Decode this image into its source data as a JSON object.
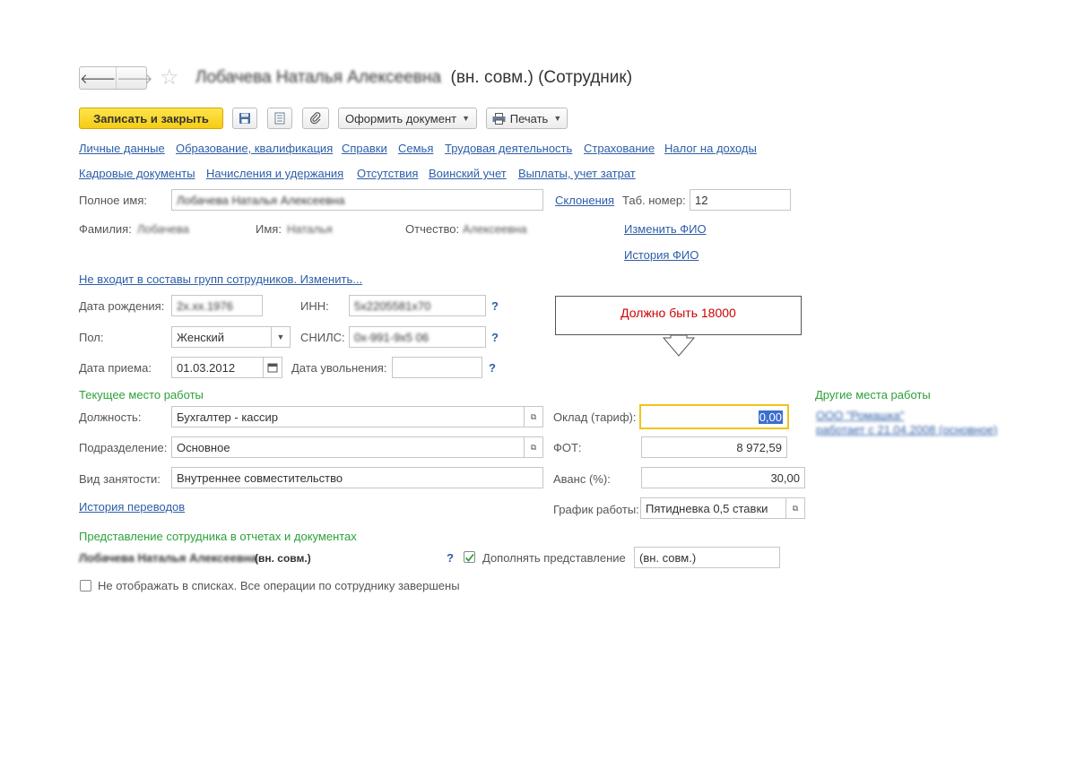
{
  "window": {
    "title_name": "Лобачева Наталья Алексеевна",
    "title_suffix": "(вн. совм.) (Сотрудник)",
    "back_glyph": "🡐",
    "forward_glyph": "🡒",
    "star_glyph": "☆"
  },
  "toolbar": {
    "save_close": "Записать и закрыть",
    "create_document": "Оформить документ",
    "print": "Печать"
  },
  "links_row1": [
    "Личные данные",
    "Образование, квалификация",
    "Справки",
    "Семья",
    "Трудовая деятельность",
    "Страхование",
    "Налог на доходы"
  ],
  "links_row2": [
    "Кадровые документы",
    "Начисления и удержания",
    "Отсутствия",
    "Воинский учет",
    "Выплаты, учет затрат"
  ],
  "name": {
    "full_name_label": "Полное имя:",
    "full_name_value": "Лобачева Наталья Алексеевна",
    "declensions_link": "Склонения",
    "tab_number_label": "Таб. номер:",
    "tab_number_value": "12",
    "surname_label": "Фамилия:",
    "surname_value": "Лобачева",
    "firstname_label": "Имя:",
    "firstname_value": "Наталья",
    "patronymic_label": "Отчество:",
    "patronymic_value": "Алексеевна",
    "change_fio_link": "Изменить ФИО",
    "fio_history_link": "История ФИО"
  },
  "groups_link": "Не входит в составы групп сотрудников. Изменить...",
  "personal": {
    "birth_label": "Дата рождения:",
    "birth_value": "2х.хх.1976",
    "inn_label": "ИНН:",
    "inn_value": "5х2205581х70",
    "gender_label": "Пол:",
    "gender_value": "Женский",
    "snils_label": "СНИЛС:",
    "snils_value": "0х-991-9х5 06",
    "hire_label": "Дата приема:",
    "hire_value": "01.03.2012",
    "dismiss_label": "Дата увольнения:",
    "dismiss_value": "",
    "help_mark": "?"
  },
  "callout": {
    "text": "Должно быть 18000"
  },
  "work": {
    "section_title": "Текущее место работы",
    "position_label": "Должность:",
    "position_value": "Бухгалтер - кассир",
    "department_label": "Подразделение:",
    "department_value": "Основное",
    "employment_label": "Вид занятости:",
    "employment_value": "Внутреннее совместительство",
    "transfer_history_link": "История переводов",
    "salary_label": "Оклад (тариф):",
    "salary_value": "0,00",
    "fot_label": "ФОТ:",
    "fot_value": "8 972,59",
    "advance_label": "Аванс (%):",
    "advance_value": "30,00",
    "schedule_label": "График работы:",
    "schedule_value": "Пятидневка 0,5 ставки"
  },
  "other_work": {
    "section_title": "Другие места работы",
    "org_link": "ООО \"Ромашка\"",
    "works_since": "работает с 21.04.2008 (основное)"
  },
  "representation": {
    "section_title": "Представление сотрудника в отчетах и документах",
    "name_text": "Лобачева Наталья Алексеевна",
    "suffix_text": "(вн. совм.)",
    "help_mark": "?",
    "supplement_label": "Дополнять представление",
    "supplement_checked": true,
    "supplement_value": "(вн. совм.)"
  },
  "hide_in_lists_label": "Не отображать в списках. Все операции по сотруднику завершены",
  "colors": {
    "link": "#2d5ea8",
    "section": "#2ca13a",
    "primary_button": "#f5cc14",
    "callout_text": "#cc0000",
    "focus_border": "#f0c419"
  }
}
